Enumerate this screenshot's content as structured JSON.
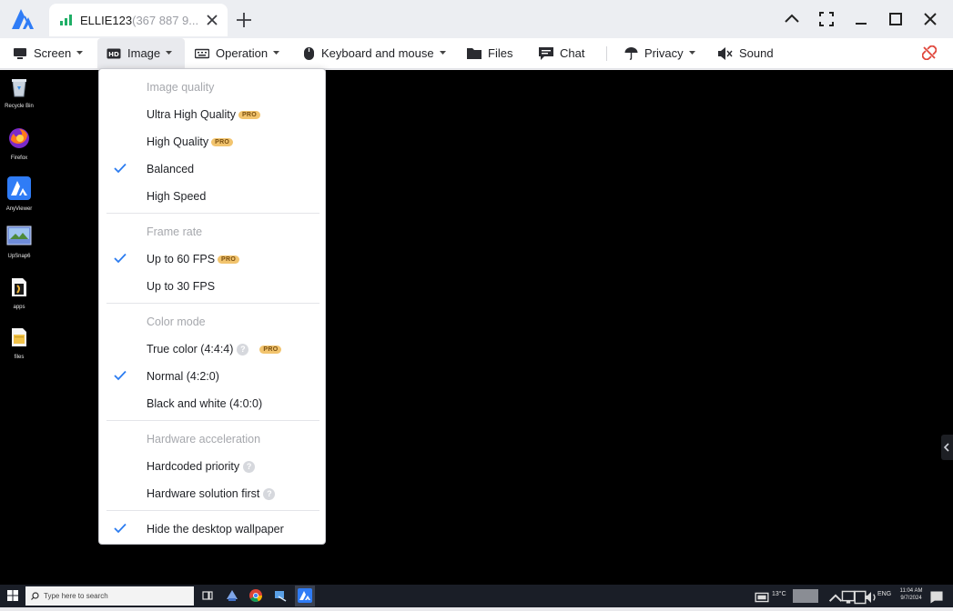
{
  "titlebar": {
    "tab": {
      "name": "ELLIE123",
      "id_text": "(367 887 9..."
    }
  },
  "toolbar": {
    "items": [
      {
        "label": "Screen",
        "icon": "monitor-icon",
        "has_caret": true
      },
      {
        "label": "Image",
        "icon": "hd-icon",
        "has_caret": true,
        "active": true
      },
      {
        "label": "Operation",
        "icon": "keyboard-icon",
        "has_caret": true
      },
      {
        "label": "Keyboard and mouse",
        "icon": "mouse-icon",
        "has_caret": true
      },
      {
        "label": "Files",
        "icon": "folder-icon",
        "has_caret": false
      },
      {
        "label": "Chat",
        "icon": "chat-icon",
        "has_caret": false
      },
      {
        "label": "Privacy",
        "icon": "umbrella-icon",
        "has_caret": true
      },
      {
        "label": "Sound",
        "icon": "speaker-muted-icon",
        "has_caret": false
      }
    ]
  },
  "menu": {
    "image_quality": {
      "heading": "Image quality",
      "ultra": "Ultra High Quality",
      "high": "High Quality",
      "balanced": "Balanced",
      "speed": "High Speed"
    },
    "frame_rate": {
      "heading": "Frame rate",
      "fps60": "Up to 60 FPS",
      "fps30": "Up to 30 FPS"
    },
    "color_mode": {
      "heading": "Color mode",
      "true_color": "True color (4:4:4)",
      "normal": "Normal (4:2:0)",
      "bw": "Black and white (4:0:0)"
    },
    "hardware": {
      "heading": "Hardware acceleration",
      "hardcoded": "Hardcoded priority",
      "solution": "Hardware solution first"
    },
    "hide_wallpaper": "Hide the desktop wallpaper",
    "pro_badge": "PRO",
    "help_glyph": "?"
  },
  "desktop": {
    "icons": [
      "Recycle Bin",
      "Firefox",
      "AnyViewer",
      "UpSnap6",
      "apps",
      "files"
    ]
  },
  "taskbar": {
    "search_placeholder": "Type here to search",
    "weather": "13°C",
    "lang": "ENG",
    "time": "11:04 AM",
    "date": "9/7/2024"
  },
  "colors": {
    "accent": "#2a7bf0",
    "pro_badge_bg": "#f2c46e",
    "remote_bg": "#000000",
    "disconnect": "#e0453a"
  }
}
